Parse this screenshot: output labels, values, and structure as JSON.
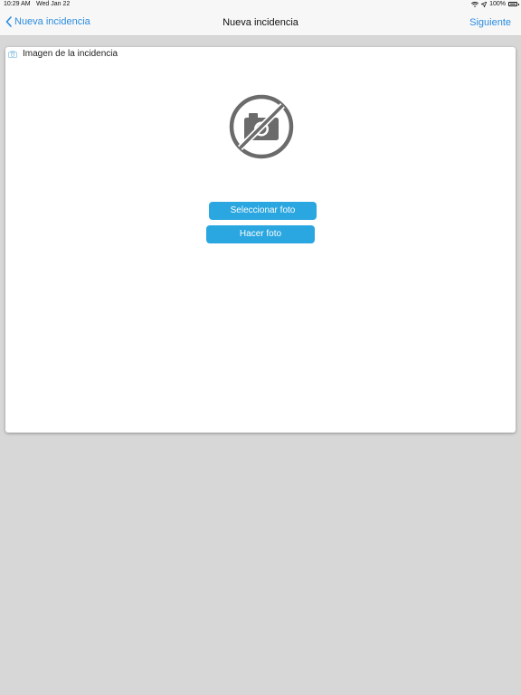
{
  "status_bar": {
    "time": "10:29 AM",
    "date": "Wed Jan 22",
    "battery_text": "100%",
    "wifi_icon": "wifi-icon",
    "location_icon": "location-arrow-icon",
    "battery_icon": "battery-icon"
  },
  "nav": {
    "back_label": "Nueva incidencia",
    "back_icon": "chevron-left-icon",
    "title": "Nueva incidencia",
    "next_label": "Siguiente"
  },
  "card": {
    "header_icon": "camera-icon",
    "header_label": "Imagen de la incidencia",
    "placeholder_icon": "no-camera-icon",
    "select_photo_label": "Seleccionar foto",
    "take_photo_label": "Hacer foto"
  },
  "colors": {
    "accent": "#2b8ce0",
    "button": "#2aa6e0",
    "background": "#d7d7d7",
    "icon_gray": "#6b6b6b"
  }
}
